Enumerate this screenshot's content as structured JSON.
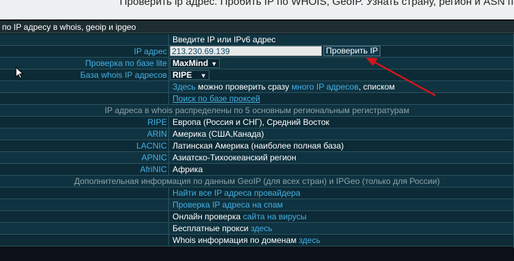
{
  "top_text": "Проверить ip адрес. Пробить IP по WHOIS, GeoIP. Узнать страну, регион и ASN по",
  "caption": "по IP адресу в whois, geoip и ipgeo",
  "header": "Введите IP или IPv6 адрес",
  "ip_label": "IP адрес",
  "ip_value": "213.230.69.139",
  "check_button": "Проверить IP",
  "lite_label": "Проверка по базе lite",
  "lite_value": "MaxMind",
  "whois_label": "База whois IP адресов",
  "whois_value": "RIPE",
  "multi": {
    "part1": "Здесь",
    "part2": " можно проверить сразу ",
    "part3": "много IP адресов",
    "part4": ", ",
    "part5": "списком"
  },
  "proxy_search": "Поиск по базе прокcей",
  "registrars_note": "IP адреса в whois распределены по 5 основным региональным регистратурам",
  "registrars": [
    {
      "name": "RIPE",
      "desc": "Европа (Россия и СНГ), Средний Восток"
    },
    {
      "name": "ARIN",
      "desc": "Америка (США,Канада)"
    },
    {
      "name": "LACNIC",
      "desc": "Латинская Америка (наиболее полная база)"
    },
    {
      "name": "APNIC",
      "desc": "Азиатско-Тихоокеанский регион"
    },
    {
      "name": "AfriNIC",
      "desc": "Африка"
    }
  ],
  "geo_note": "Дополнительная информация по данным GeoIP (для всех стран) и IPGeo (только для России)",
  "links": {
    "provider": "Найти все IP адреса провайдера",
    "spam": "Проверка IP адреса на спам",
    "virus_a": "Онлайн проверка",
    "virus_b": " сайта на вирусы",
    "proxy_a": "Бесплатные прокси",
    "proxy_b": " здесь",
    "domains_a": "Whois информация по доменам",
    "domains_b": " здесь"
  },
  "colors": {
    "accent_link": "#44b0e6",
    "row_bg": "#0f3340",
    "arrow": "#d4151b"
  }
}
